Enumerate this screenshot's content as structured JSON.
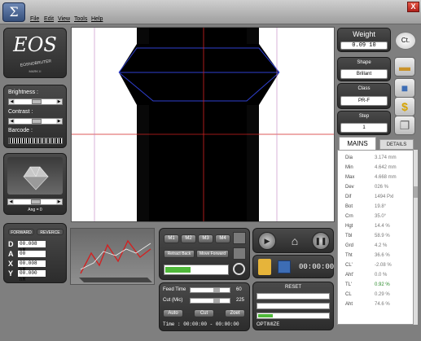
{
  "menu": [
    "File",
    "Edit",
    "View",
    "Tools",
    "Help"
  ],
  "title_bar": {
    "close": "X",
    "logo": "Σ"
  },
  "logo_panel": {
    "title": "EOS",
    "subtitle": "EOSNOBRUTER",
    "mark": "MARK II"
  },
  "adjust": {
    "brightness_label": "Brightness :",
    "contrast_label": "Contrast :",
    "barcode_label": "Barcode :",
    "brightness_value": "98",
    "contrast_value": "98"
  },
  "diamond": {
    "angle_label": "Ang = 0",
    "slider_value": "15"
  },
  "coords": {
    "forward": "FORWARD",
    "reverse": "REVERCE",
    "rows": [
      {
        "letter": "D",
        "value": "00.008 hM"
      },
      {
        "letter": "A",
        "value": "00"
      },
      {
        "letter": "X",
        "value": "00.008 hM"
      },
      {
        "letter": "Y",
        "value": "00.000 hM"
      }
    ]
  },
  "motor": {
    "buttons": [
      "M1",
      "M2",
      "M3",
      "M4"
    ],
    "retract": "Retract Back",
    "move_forward": "Move Forward",
    "progress": 0.4
  },
  "feed": {
    "feed_time_label": "Feed Time",
    "feed_time_value": "60",
    "cut_label": "Cut (Mic)",
    "cut_value": "225",
    "buttons": [
      "Auto",
      "Cut",
      "Zoet"
    ],
    "time_label": "Time :",
    "time_value": "00:00:00 - 00:00:00"
  },
  "media": {
    "timer": "00:00:00"
  },
  "reset": {
    "title": "RESET",
    "optimize": "OPTIMIZE"
  },
  "weight": {
    "label": "Weight",
    "value": "0.09 10",
    "unit_button": "Ct."
  },
  "shape": {
    "label": "Shape",
    "value": "Brillant"
  },
  "class": {
    "label": "Class",
    "value": "PR-F"
  },
  "step": {
    "label": "Step",
    "value": "1"
  },
  "tabs": {
    "mains": "MAINS",
    "details": "DETAILS"
  },
  "mains": [
    {
      "label": "Dia",
      "value": "3.174 mm"
    },
    {
      "label": "Min",
      "value": "4.642 mm"
    },
    {
      "label": "Max",
      "value": "4.668 mm"
    },
    {
      "label": "Dev",
      "value": "026 %"
    },
    {
      "label": "Dif",
      "value": "1494 Pxl"
    },
    {
      "label": "Bot",
      "value": "19.8°"
    },
    {
      "label": "Crn",
      "value": "35.0°"
    },
    {
      "label": "Hgt",
      "value": "14.4 %"
    },
    {
      "label": "Tbl",
      "value": "58.9 %"
    },
    {
      "label": "Grd",
      "value": "4.2 %"
    },
    {
      "label": "Tht",
      "value": "36.6 %"
    },
    {
      "label": "CL'",
      "value": "-2.08 %"
    },
    {
      "label": "Aht'",
      "value": "0.0 %"
    },
    {
      "label": "TL'",
      "value": "0.92 %"
    },
    {
      "label": "CL",
      "value": "0.29 %"
    },
    {
      "label": "Aht",
      "value": "74.6 %"
    }
  ],
  "colors": {
    "accent_green": "#4fb83a",
    "crosshair_red": "#d22222",
    "outline_blue": "#2f3fd0"
  }
}
